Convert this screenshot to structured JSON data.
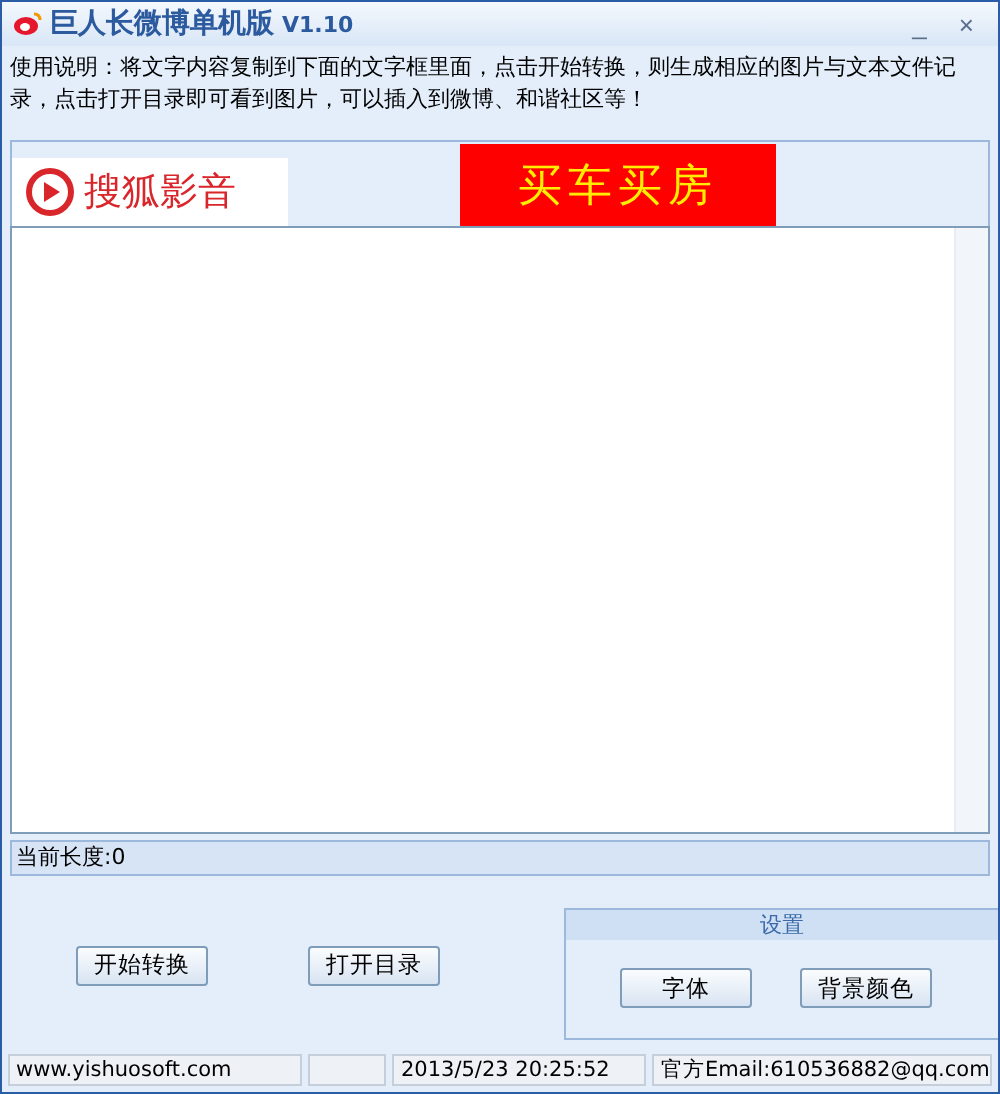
{
  "window": {
    "title": "巨人长微博单机版",
    "version": "V1.10",
    "controls": [
      "_",
      "×"
    ]
  },
  "instructions": "使用说明：将文字内容复制到下面的文字框里面，点击开始转换，则生成相应的图片与文本文件记录，点击打开目录即可看到图片，可以插入到微博、和谐社区等！",
  "banner": {
    "logo_text": "搜狐影音",
    "ad_text": "买车买房"
  },
  "length_label": "当前长度:0",
  "buttons": [
    "开始转换",
    "打开目录"
  ],
  "settings": {
    "title": "设置",
    "buttons": [
      "字体",
      "背景颜色"
    ]
  },
  "status_bar": [
    "www.yishuosoft.com",
    "2013/5/23 20:25:52",
    "官方Email:610536882@qq.com"
  ]
}
